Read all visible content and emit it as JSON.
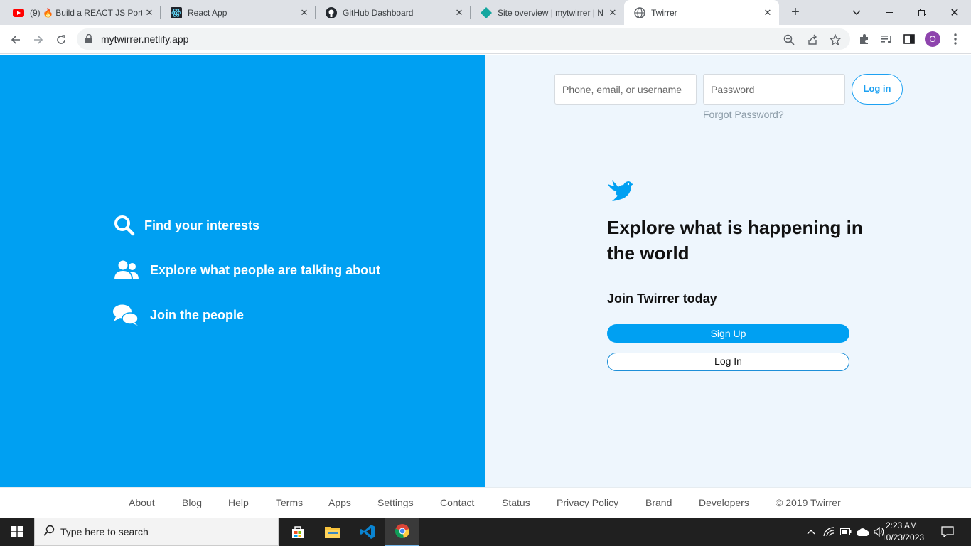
{
  "browser": {
    "tabs": [
      {
        "title": "(9) 🔥 Build a REACT JS Portf",
        "icon": "youtube-icon",
        "active": false
      },
      {
        "title": "React App",
        "icon": "react-icon",
        "active": false
      },
      {
        "title": "GitHub Dashboard",
        "icon": "github-icon",
        "active": false
      },
      {
        "title": "Site overview | mytwirrer | N",
        "icon": "netlify-icon",
        "active": false
      },
      {
        "title": "Twirrer",
        "icon": "globe-icon",
        "active": true
      }
    ],
    "url": "mytwirrer.netlify.app",
    "profile_initial": "O"
  },
  "features": {
    "items": [
      {
        "label": "Find your interests",
        "icon": "search-icon"
      },
      {
        "label": "Explore what people are talking about",
        "icon": "people-icon"
      },
      {
        "label": "Join the people",
        "icon": "chat-icon"
      }
    ]
  },
  "login": {
    "username_placeholder": "Phone, email, or username",
    "password_placeholder": "Password",
    "login_label": "Log in",
    "forgot_label": "Forgot Password?"
  },
  "hero": {
    "headline": "Explore what is happening in the world",
    "join_label": "Join Twirrer today",
    "signup_label": "Sign Up",
    "login_label": "Log In"
  },
  "footer": {
    "links": [
      "About",
      "Blog",
      "Help",
      "Terms",
      "Apps",
      "Settings",
      "Contact",
      "Status",
      "Privacy Policy",
      "Brand",
      "Developers",
      "© 2019 Twirrer"
    ]
  },
  "taskbar": {
    "search_placeholder": "Type here to search",
    "time": "2:23 AM",
    "date": "10/23/2023"
  },
  "colors": {
    "brand_blue": "#00a0f2",
    "right_bg": "#eef6fd"
  }
}
